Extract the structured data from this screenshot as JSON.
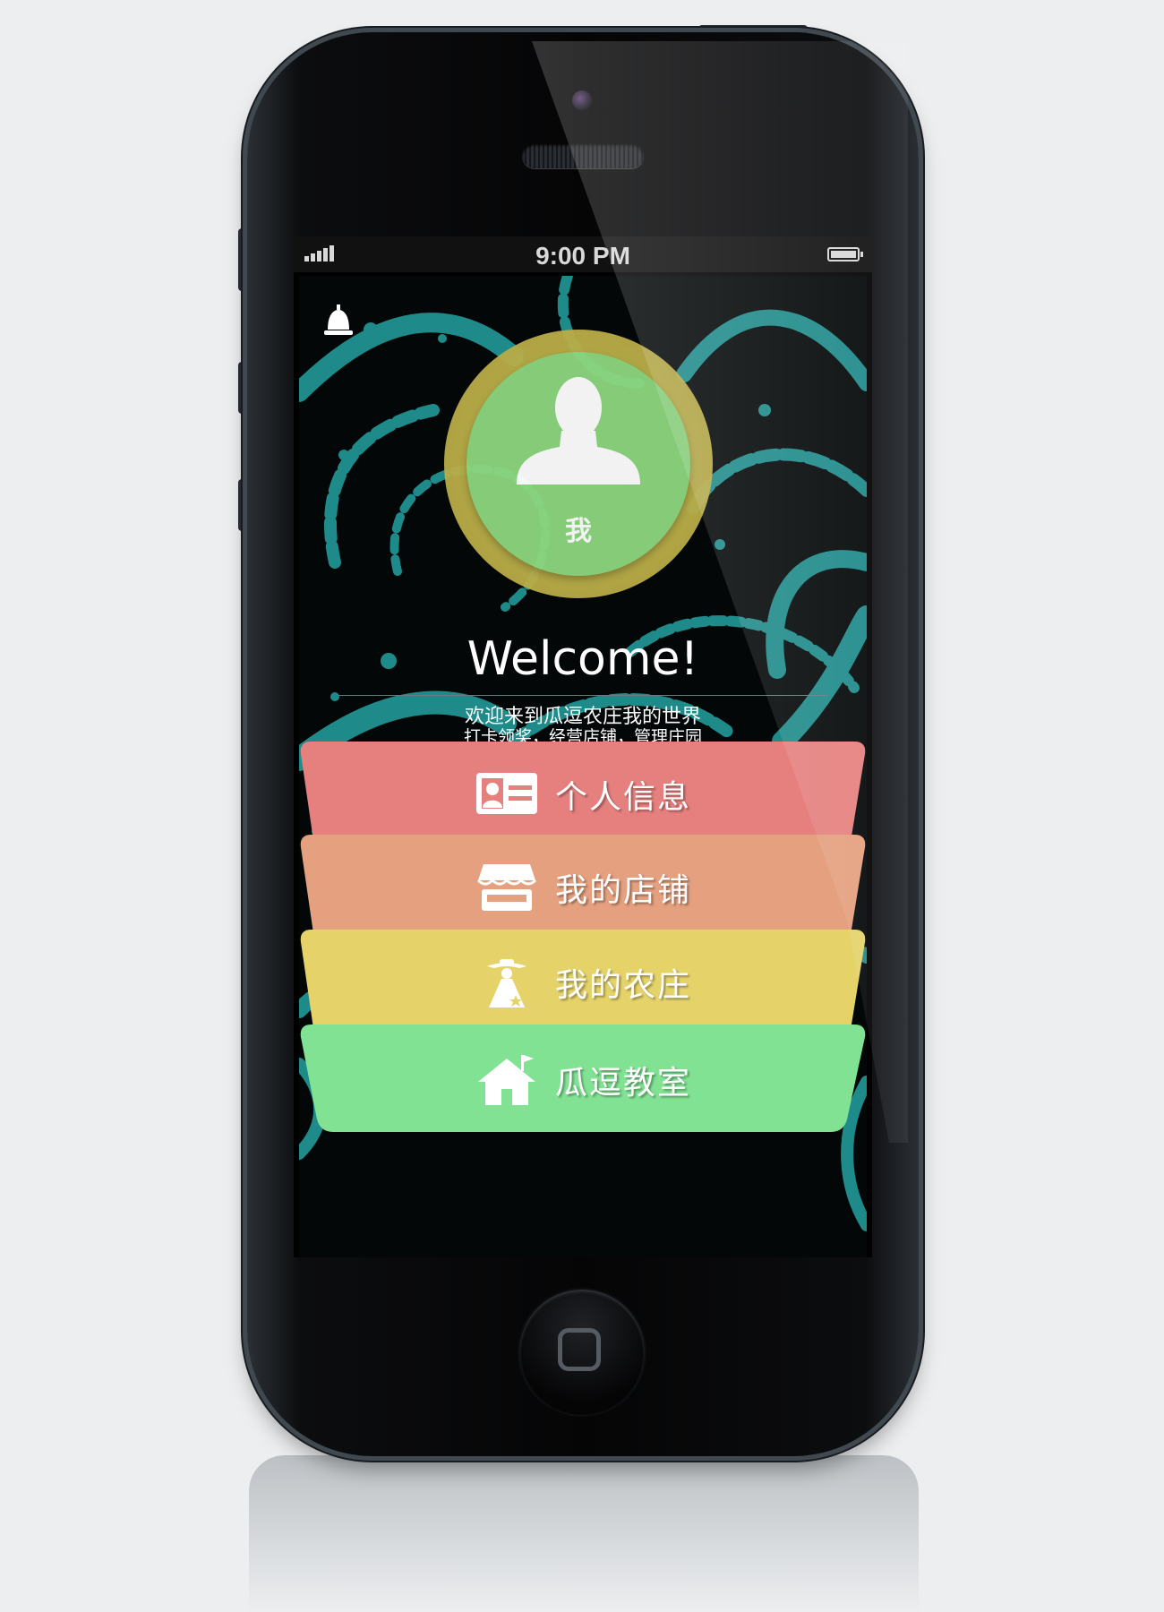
{
  "status_bar": {
    "time": "9:00 PM"
  },
  "profile": {
    "avatar_label": "我"
  },
  "welcome": {
    "title": "Welcome!",
    "subtitle_line1": "欢迎来到瓜逗农庄我的世界",
    "subtitle_line2": "打卡领奖，经营店铺，管理庄园"
  },
  "menu": [
    {
      "label": "个人信息",
      "icon": "id-card-icon",
      "color": "#e5807e"
    },
    {
      "label": "我的店铺",
      "icon": "storefront-icon",
      "color": "#e4a07f"
    },
    {
      "label": "我的农庄",
      "icon": "farmer-icon",
      "color": "#e5d36a"
    },
    {
      "label": "瓜逗教室",
      "icon": "house-flag-icon",
      "color": "#82e294"
    }
  ],
  "colors": {
    "background": "#eceef0",
    "avatar_ring": "#bfb24c",
    "avatar_fill": "#8dd67f",
    "pattern": "#1f8a8a"
  }
}
